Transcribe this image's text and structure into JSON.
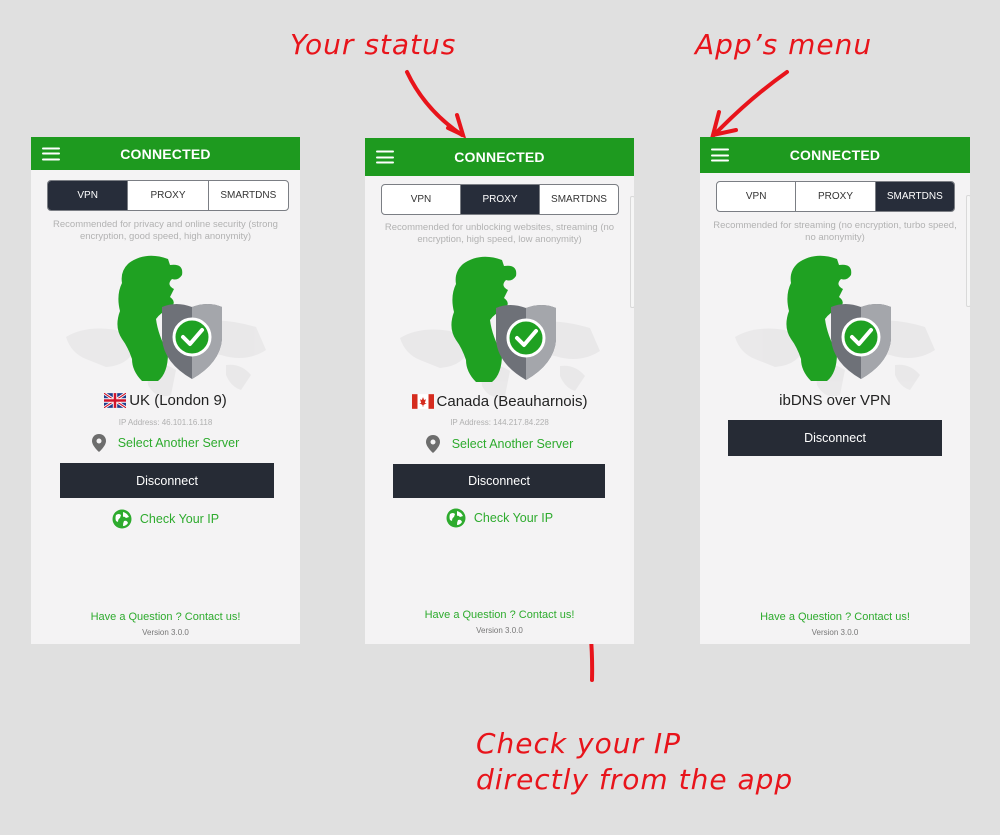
{
  "annotations": {
    "status": "Your status",
    "menu": "App’s menu",
    "check_ip_line1": "Check your IP",
    "check_ip_line2": "directly from the app"
  },
  "colors": {
    "header_green": "#1e9a1f",
    "link_green": "#2eab2e",
    "dark_button": "#262b35",
    "annotation_red": "#e8141b"
  },
  "screens": [
    {
      "status": "CONNECTED",
      "tabs": [
        "VPN",
        "PROXY",
        "SMARTDNS"
      ],
      "active_tab": "VPN",
      "description": "Recommended for privacy and online security (strong encryption, good speed, high anonymity)",
      "server": {
        "flag": "uk-flag",
        "name": "UK (London 9)"
      },
      "ip_address": "IP Address: 46.101.16.118",
      "select_server": "Select Another Server",
      "disconnect": "Disconnect",
      "check_ip": "Check Your IP",
      "contact": "Have a Question ? Contact us!",
      "version": "Version 3.0.0"
    },
    {
      "status": "CONNECTED",
      "tabs": [
        "VPN",
        "PROXY",
        "SMARTDNS"
      ],
      "active_tab": "PROXY",
      "description": "Recommended for unblocking websites, streaming (no encryption, high speed, low anonymity)",
      "server": {
        "flag": "canada-flag",
        "name": "Canada (Beauharnois)"
      },
      "ip_address": "IP Address: 144.217.84.228",
      "select_server": "Select Another Server",
      "disconnect": "Disconnect",
      "check_ip": "Check Your IP",
      "contact": "Have a Question ? Contact us!",
      "version": "Version 3.0.0"
    },
    {
      "status": "CONNECTED",
      "tabs": [
        "VPN",
        "PROXY",
        "SMARTDNS"
      ],
      "active_tab": "SMARTDNS",
      "description": "Recommended for streaming (no encryption, turbo speed, no anonymity)",
      "server": {
        "name": "ibDNS over VPN"
      },
      "disconnect": "Disconnect",
      "contact": "Have a Question ? Contact us!",
      "version": "Version 3.0.0"
    }
  ]
}
